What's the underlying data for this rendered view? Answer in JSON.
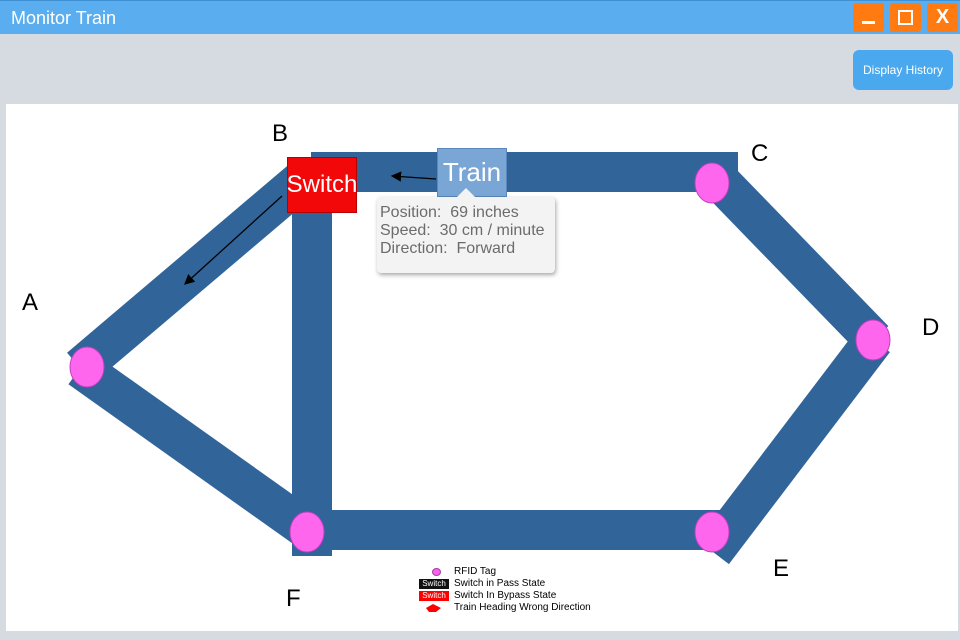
{
  "window": {
    "title": "Monitor Train",
    "minimize_icon": "minimize-icon",
    "maximize_icon": "maximize-icon",
    "close_label": "X"
  },
  "toolbar": {
    "display_history_label": "Display History"
  },
  "map": {
    "track_color": "#31659a",
    "rfid_color": "#ff66ee",
    "nodes": {
      "A": "A",
      "B": "B",
      "C": "C",
      "D": "D",
      "E": "E",
      "F": "F"
    },
    "switch_label": "Switch",
    "switch_state_color": "#f20808",
    "train_label": "Train"
  },
  "tooltip": {
    "position": "Position:  69 inches",
    "speed": "Speed:  30 cm / minute",
    "direction": "Direction:  Forward"
  },
  "legend": {
    "rfid_tag": "RFID Tag",
    "switch_chip": "Switch",
    "pass_state": "Switch in Pass State",
    "bypass_state": "Switch In Bypass State",
    "wrong_direction": "Train Heading Wrong Direction"
  }
}
